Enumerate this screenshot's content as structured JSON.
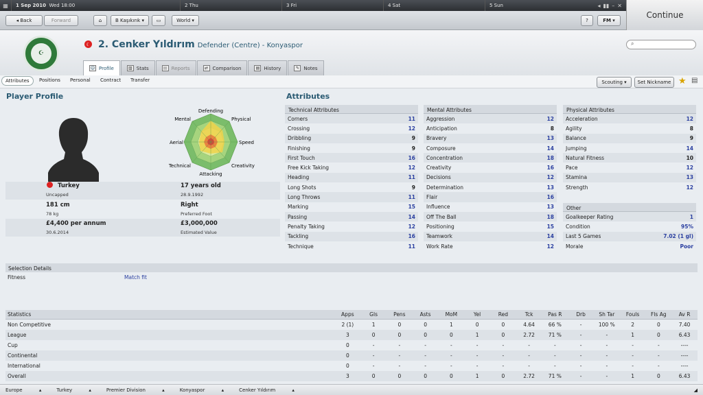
{
  "topbar": {
    "date": "1 Sep 2010",
    "day_time": "Wed 18:00",
    "days": [
      "2 Thu",
      "3 Fri",
      "4 Sat",
      "5 Sun"
    ]
  },
  "continue_label": "Continue",
  "nav": {
    "back": "Back",
    "forward": "Forward",
    "team": "B Kaşıkırık",
    "world": "World",
    "fm": "FM"
  },
  "player": {
    "number_name": "2. Cenker Yıldırım",
    "position": "Defender (Centre) - Konyaspor",
    "club_logo": "KONYASPOR"
  },
  "tabs": [
    "Profile",
    "Stats",
    "Reports",
    "Comparison",
    "History",
    "Notes"
  ],
  "subtabs": [
    "Attributes",
    "Positions",
    "Personal",
    "Contract",
    "Transfer"
  ],
  "actions": {
    "scouting": "Scouting",
    "set_nickname": "Set Nickname"
  },
  "profile": {
    "title": "Player Profile",
    "nation": "Turkey",
    "caps": "Uncapped",
    "age": "17 years old",
    "dob": "28.9.1992",
    "height": "181 cm",
    "weight": "78 kg",
    "foot": "Right",
    "foot_label": "Preferred Foot",
    "wage": "£4,400 per annum",
    "contract": "30.6.2014",
    "value": "£3,000,000",
    "value_label": "Estimated Value",
    "radar": {
      "labels": [
        "Defending",
        "Physical",
        "Speed",
        "Creativity",
        "Attacking",
        "Technical",
        "Aerial",
        "Mental"
      ]
    }
  },
  "attributes_title": "Attributes",
  "technical": {
    "title": "Technical Attributes",
    "items": [
      [
        "Corners",
        "11"
      ],
      [
        "Crossing",
        "12"
      ],
      [
        "Dribbling",
        "9"
      ],
      [
        "Finishing",
        "9"
      ],
      [
        "First Touch",
        "16"
      ],
      [
        "Free Kick Taking",
        "12"
      ],
      [
        "Heading",
        "11"
      ],
      [
        "Long Shots",
        "9"
      ],
      [
        "Long Throws",
        "11"
      ],
      [
        "Marking",
        "15"
      ],
      [
        "Passing",
        "14"
      ],
      [
        "Penalty Taking",
        "12"
      ],
      [
        "Tackling",
        "16"
      ],
      [
        "Technique",
        "11"
      ]
    ]
  },
  "mental": {
    "title": "Mental Attributes",
    "items": [
      [
        "Aggression",
        "12"
      ],
      [
        "Anticipation",
        "8"
      ],
      [
        "Bravery",
        "13"
      ],
      [
        "Composure",
        "14"
      ],
      [
        "Concentration",
        "18"
      ],
      [
        "Creativity",
        "16"
      ],
      [
        "Decisions",
        "12"
      ],
      [
        "Determination",
        "13"
      ],
      [
        "Flair",
        "16"
      ],
      [
        "Influence",
        "13"
      ],
      [
        "Off The Ball",
        "18"
      ],
      [
        "Positioning",
        "15"
      ],
      [
        "Teamwork",
        "14"
      ],
      [
        "Work Rate",
        "12"
      ]
    ]
  },
  "physical": {
    "title": "Physical Attributes",
    "items": [
      [
        "Acceleration",
        "12"
      ],
      [
        "Agility",
        "8"
      ],
      [
        "Balance",
        "9"
      ],
      [
        "Jumping",
        "14"
      ],
      [
        "Natural Fitness",
        "10"
      ],
      [
        "Pace",
        "12"
      ],
      [
        "Stamina",
        "13"
      ],
      [
        "Strength",
        "12"
      ]
    ]
  },
  "other": {
    "title": "Other",
    "items": [
      [
        "Goalkeeper Rating",
        "1"
      ],
      [
        "Condition",
        "95%"
      ],
      [
        "Last 5 Games",
        "7.02 (1 gl)"
      ],
      [
        "Morale",
        "Poor"
      ]
    ]
  },
  "selection": {
    "title": "Selection Details",
    "label": "Fitness",
    "value": "Match fit"
  },
  "statistics": {
    "headers": [
      "Statistics",
      "Apps",
      "Gls",
      "Pens",
      "Asts",
      "MoM",
      "Yel",
      "Red",
      "Tck",
      "Pas R",
      "Drb",
      "Sh Tar",
      "Fouls",
      "Fls Ag",
      "Av R"
    ],
    "rows": [
      [
        "Non Competitive",
        "2 (1)",
        "1",
        "0",
        "0",
        "1",
        "0",
        "0",
        "4.64",
        "66 %",
        "-",
        "100 %",
        "2",
        "0",
        "7.40"
      ],
      [
        "League",
        "3",
        "0",
        "0",
        "0",
        "0",
        "1",
        "0",
        "2.72",
        "71 %",
        "-",
        "-",
        "1",
        "0",
        "6.43"
      ],
      [
        "Cup",
        "0",
        "-",
        "-",
        "-",
        "-",
        "-",
        "-",
        "-",
        "-",
        "-",
        "-",
        "-",
        "-",
        "----"
      ],
      [
        "Continental",
        "0",
        "-",
        "-",
        "-",
        "-",
        "-",
        "-",
        "-",
        "-",
        "-",
        "-",
        "-",
        "-",
        "----"
      ],
      [
        "International",
        "0",
        "-",
        "-",
        "-",
        "-",
        "-",
        "-",
        "-",
        "-",
        "-",
        "-",
        "-",
        "-",
        "----"
      ],
      [
        "Overall",
        "3",
        "0",
        "0",
        "0",
        "0",
        "1",
        "0",
        "2.72",
        "71 %",
        "-",
        "-",
        "1",
        "0",
        "6.43"
      ]
    ]
  },
  "breadcrumb": [
    "Europe",
    "Turkey",
    "Premier Division",
    "Konyaspor",
    "Cenker Yıldırım"
  ]
}
